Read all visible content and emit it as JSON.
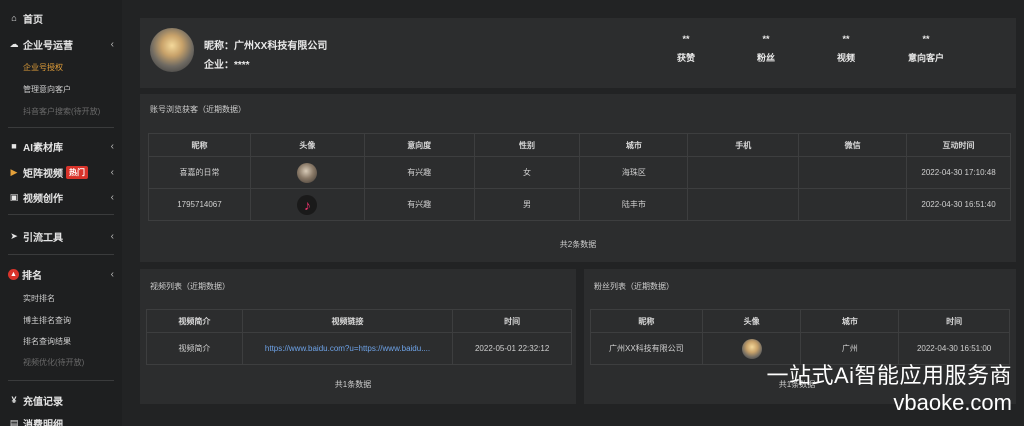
{
  "sidebar": {
    "home": "首页",
    "enterprise": "企业号运营",
    "enterprise_subs": [
      "企业号授权",
      "管理意向客户",
      "抖音客户搜索(待开放)"
    ],
    "ai_library": "AI素材库",
    "matrix_video": "矩阵视频",
    "hot_badge": "热门",
    "video_create": "视频创作",
    "traffic_tools": "引流工具",
    "ranking": "排名",
    "ranking_subs": [
      "实时排名",
      "博主排名查询",
      "排名查询结果",
      "视频优化(待开放)"
    ],
    "recharge": "充值记录",
    "expense": "消费明细"
  },
  "profile": {
    "nickname_label": "昵称：",
    "nickname": "广州XX科技有限公司",
    "company_label": "企业：",
    "company": "****",
    "stats": [
      {
        "value": "**",
        "label": "获赞"
      },
      {
        "value": "**",
        "label": "粉丝"
      },
      {
        "value": "**",
        "label": "视频"
      },
      {
        "value": "**",
        "label": "意向客户"
      }
    ]
  },
  "visitors": {
    "title": "账号浏览获客（近期数据）",
    "headers": [
      "昵称",
      "头像",
      "意向度",
      "性别",
      "城市",
      "手机",
      "微信",
      "互动时间"
    ],
    "rows": [
      {
        "name": "喜嘉的日常",
        "intent": "有兴趣",
        "gender": "女",
        "city": "海珠区",
        "phone": "",
        "wechat": "",
        "time": "2022-04-30 17:10:48"
      },
      {
        "name": "1795714067",
        "intent": "有兴趣",
        "gender": "男",
        "city": "陆丰市",
        "phone": "",
        "wechat": "",
        "time": "2022-04-30 16:51:40"
      }
    ],
    "footer": "共2条数据"
  },
  "videos": {
    "title": "视频列表（近期数据）",
    "headers": [
      "视频简介",
      "视频链接",
      "时间"
    ],
    "rows": [
      {
        "intro": "视频简介",
        "link": "https://www.baidu.com?u=https://www.baidu....",
        "time": "2022-05-01 22:32:12"
      }
    ],
    "footer": "共1条数据"
  },
  "fans": {
    "title": "粉丝列表（近期数据）",
    "headers": [
      "昵称",
      "头像",
      "城市",
      "时间"
    ],
    "rows": [
      {
        "name": "广州XX科技有限公司",
        "city": "广州",
        "time": "2022-04-30 16:51:00"
      }
    ],
    "footer": "共1条数据"
  },
  "watermark": {
    "line1": "一站式Ai智能应用服务商",
    "line2": "vbaoke.com"
  }
}
